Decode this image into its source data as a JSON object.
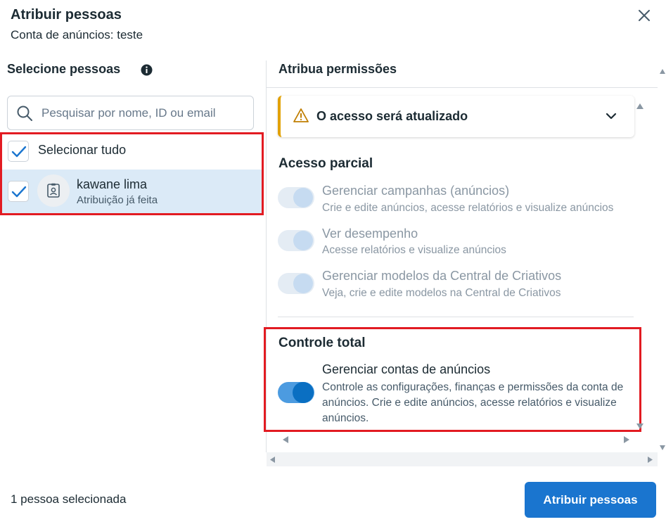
{
  "dialog": {
    "title": "Atribuir pessoas",
    "subtitle": "Conta de anúncios: teste"
  },
  "left": {
    "heading": "Selecione pessoas",
    "search_placeholder": "Pesquisar por nome, ID ou email",
    "select_all": {
      "label": "Selecionar tudo",
      "checked": true
    },
    "people": [
      {
        "name": "kawane lima",
        "status": "Atribuição já feita",
        "checked": true
      }
    ]
  },
  "right": {
    "heading": "Atribua permissões",
    "notice": "O acesso será atualizado",
    "partial": {
      "title": "Acesso parcial",
      "items": [
        {
          "title": "Gerenciar campanhas (anúncios)",
          "desc": "Crie e edite anúncios, acesse relatórios e visualize anúncios",
          "enabled": true,
          "disabled": true
        },
        {
          "title": "Ver desempenho",
          "desc": "Acesse relatórios e visualize anúncios",
          "enabled": true,
          "disabled": true
        },
        {
          "title": "Gerenciar modelos da Central de Criativos",
          "desc": "Veja, crie e edite modelos na Central de Criativos",
          "enabled": true,
          "disabled": true
        }
      ]
    },
    "full": {
      "title": "Controle total",
      "items": [
        {
          "title": "Gerenciar contas de anúncios",
          "desc": "Controle as configurações, finanças e permissões da conta de anúncios. Crie e edite anúncios, acesse relatórios e visualize anúncios.",
          "enabled": true
        }
      ]
    }
  },
  "footer": {
    "selected_count": "1 pessoa selecionada",
    "assign_button": "Atribuir pessoas"
  },
  "colors": {
    "primary": "#1a75cf",
    "selected_row": "#dbeaf7",
    "warning": "#e2a100",
    "highlight_box": "#e21b22"
  }
}
